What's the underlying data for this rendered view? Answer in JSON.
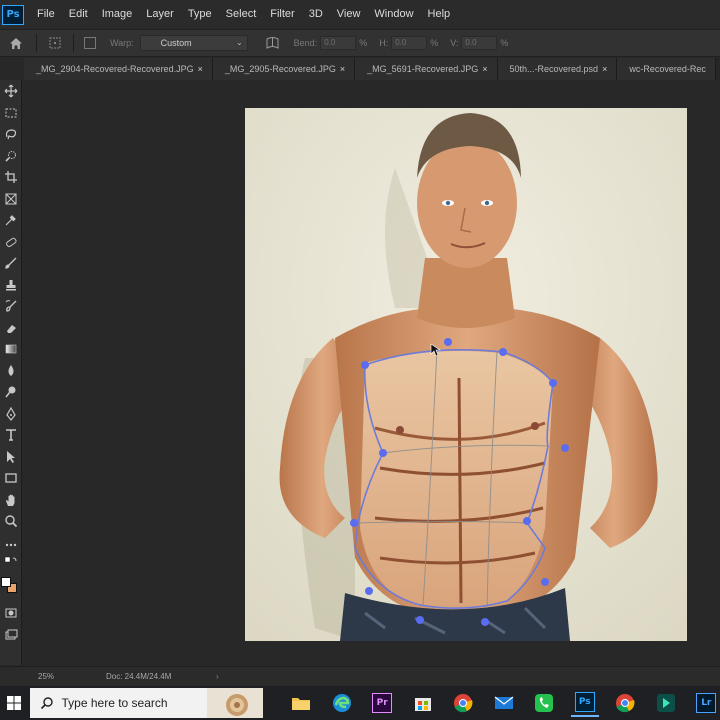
{
  "app": {
    "logo": "Ps"
  },
  "menu": [
    "File",
    "Edit",
    "Image",
    "Layer",
    "Type",
    "Select",
    "Filter",
    "3D",
    "View",
    "Window",
    "Help"
  ],
  "options": {
    "warp_label": "Warp:",
    "warp_value": "Custom",
    "bend_label": "Bend:",
    "bend_value": "0.0",
    "h_label": "H:",
    "h_value": "0.0",
    "v_label": "V:",
    "v_value": "0.0",
    "percent": "%"
  },
  "tabs": [
    {
      "label": "_MG_2904-Recovered-Recovered.JPG",
      "close": "×"
    },
    {
      "label": "_MG_2905-Recovered.JPG",
      "close": "×"
    },
    {
      "label": "_MG_5691-Recovered.JPG",
      "close": "×"
    },
    {
      "label": "50th...-Recovered.psd",
      "close": "×"
    },
    {
      "label": "wc-Recovered-Rec",
      "close": ""
    }
  ],
  "status": {
    "zoom": "25%",
    "doc": "Doc: 24.4M/24.4M",
    "arrow": "›"
  },
  "taskbar": {
    "search_placeholder": "Type here to search"
  },
  "colors": {
    "foreground": "#ffffff",
    "background": "#e8a46a",
    "warp_mesh": "#6e7bd8"
  }
}
